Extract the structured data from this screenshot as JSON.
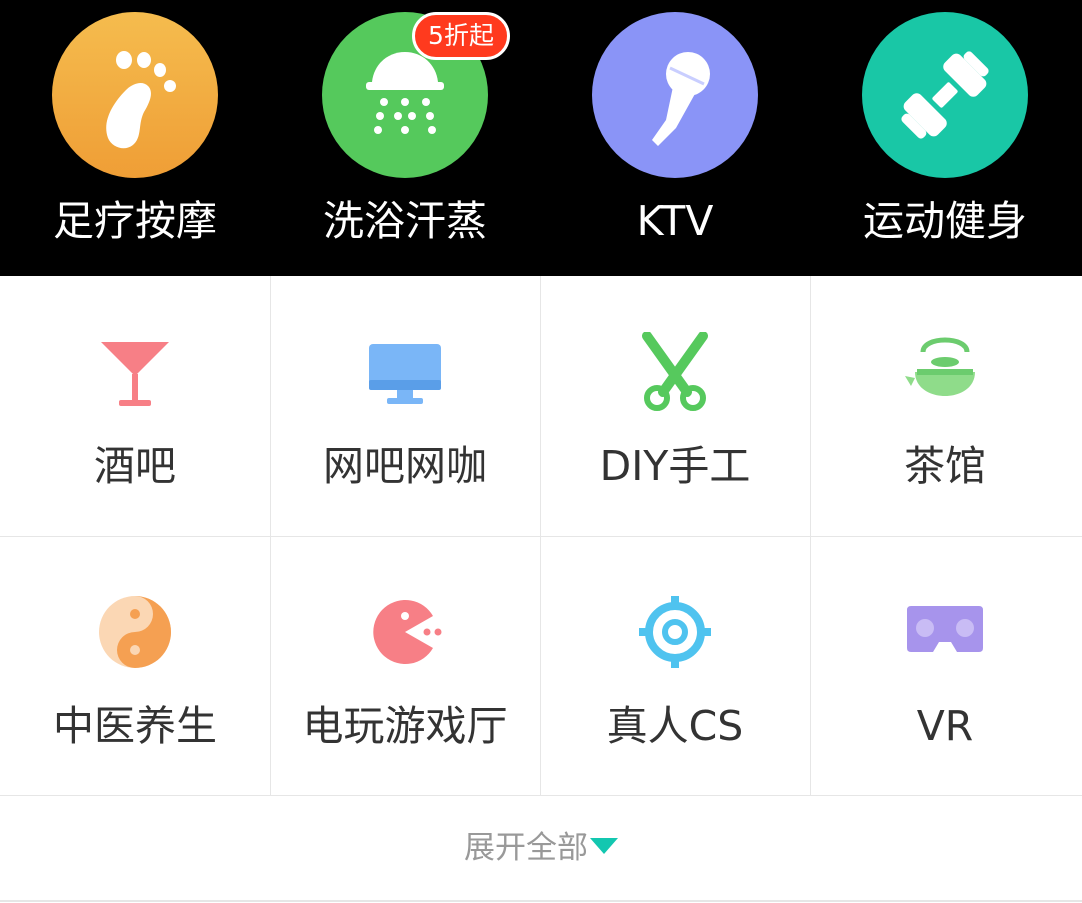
{
  "top_categories": [
    {
      "label": "足疗按摩",
      "icon": "foot-icon",
      "color": "#f2a93b"
    },
    {
      "label": "洗浴汗蒸",
      "icon": "shower-icon",
      "color": "#52c95b",
      "badge": "5折起"
    },
    {
      "label": "KTV",
      "icon": "microphone-icon",
      "color": "#8a94f7"
    },
    {
      "label": "运动健身",
      "icon": "dumbbell-icon",
      "color": "#19c7a6"
    }
  ],
  "grid_categories": [
    {
      "label": "酒吧",
      "icon": "cocktail-icon"
    },
    {
      "label": "网吧网咖",
      "icon": "monitor-icon"
    },
    {
      "label": "DIY手工",
      "icon": "scissors-icon"
    },
    {
      "label": "茶馆",
      "icon": "teapot-icon"
    },
    {
      "label": "中医养生",
      "icon": "yin-yang-icon"
    },
    {
      "label": "电玩游戏厅",
      "icon": "pacman-icon"
    },
    {
      "label": "真人CS",
      "icon": "crosshair-icon"
    },
    {
      "label": "VR",
      "icon": "vr-headset-icon"
    }
  ],
  "expand_all": {
    "label": "展开全部",
    "icon": "triangle-down-icon",
    "arrow_color": "#13c7b0"
  }
}
